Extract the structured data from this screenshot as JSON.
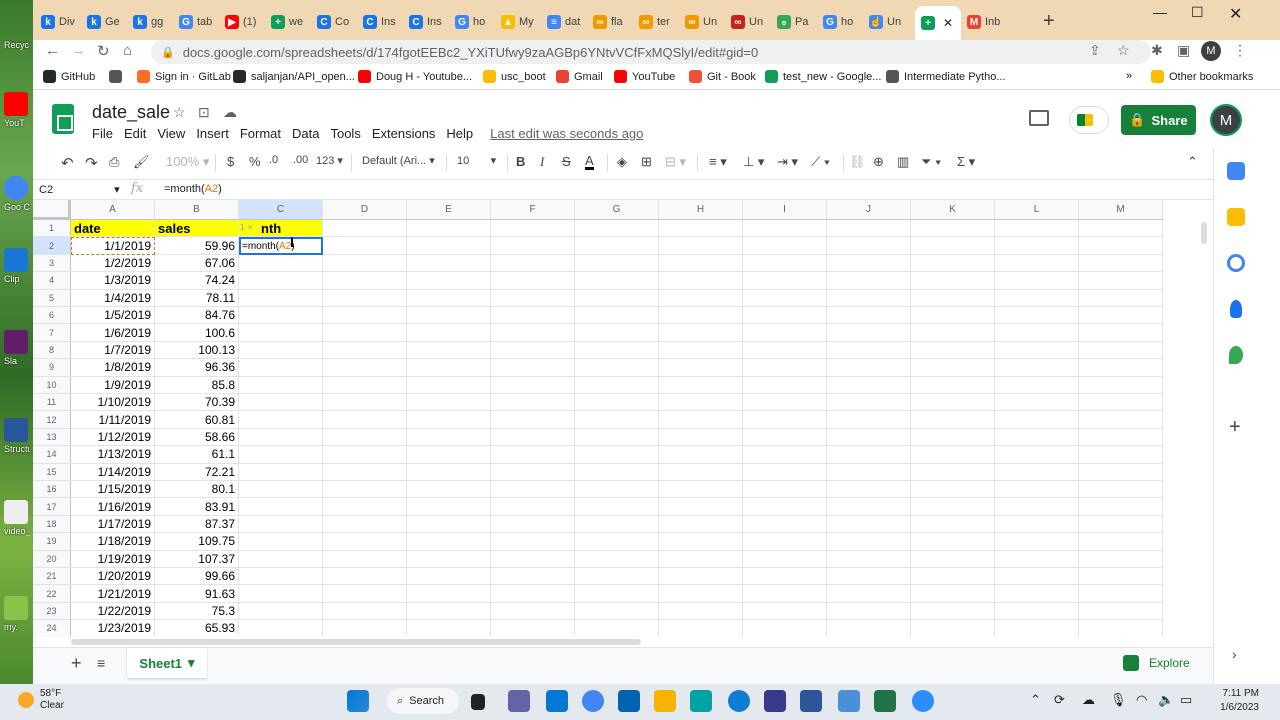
{
  "browser": {
    "tabs": [
      {
        "label": "Div",
        "fav": "k",
        "color": "#1a73e8"
      },
      {
        "label": "Ge",
        "fav": "k",
        "color": "#1a73e8"
      },
      {
        "label": "gg",
        "fav": "k",
        "color": "#1a73e8"
      },
      {
        "label": "tab",
        "fav": "G",
        "color": "#4285f4"
      },
      {
        "label": "(1)",
        "fav": "▶",
        "color": "#ff0000"
      },
      {
        "label": "we",
        "fav": "+",
        "color": "#0f9d58"
      },
      {
        "label": "Co",
        "fav": "C",
        "color": "#1a73e8"
      },
      {
        "label": "Ins",
        "fav": "C",
        "color": "#1a73e8"
      },
      {
        "label": "Ins",
        "fav": "C",
        "color": "#1a73e8"
      },
      {
        "label": "ho",
        "fav": "G",
        "color": "#4285f4"
      },
      {
        "label": "My",
        "fav": "▲",
        "color": "#fbbc04"
      },
      {
        "label": "dat",
        "fav": "≡",
        "color": "#4285f4"
      },
      {
        "label": "fla",
        "fav": "∞",
        "color": "#f29900"
      },
      {
        "label": "ter",
        "fav": "∞",
        "color": "#f29900"
      },
      {
        "label": "Un",
        "fav": "∞",
        "color": "#f29900"
      },
      {
        "label": "Un",
        "fav": "∞",
        "color": "#c5221f"
      },
      {
        "label": "Pa",
        "fav": "ℴ",
        "color": "#34a853"
      },
      {
        "label": "ho",
        "fav": "G",
        "color": "#4285f4"
      },
      {
        "label": "Un",
        "fav": "☝",
        "color": "#4285f4"
      },
      {
        "label": "",
        "fav": "+",
        "color": "#0f9d58"
      },
      {
        "label": "Inb",
        "fav": "M",
        "color": "#ea4335"
      }
    ],
    "url": "docs.google.com/spreadsheets/d/174fgotEEBc2_YXiTUfwy9zaAGBp6YNtvVCfFxMQSlyI/edit#gid=0",
    "profile_initial": "M",
    "bookmarks": [
      {
        "label": "GitHub",
        "color": "#24292e"
      },
      {
        "label": "",
        "color": "#555555"
      },
      {
        "label": "Sign in · GitLab",
        "color": "#fc6d26"
      },
      {
        "label": "saljanjan/API_open...",
        "color": "#24292e"
      },
      {
        "label": "Doug H - Youtube...",
        "color": "#ff0000"
      },
      {
        "label": "usc_boot",
        "color": "#fbbc04"
      },
      {
        "label": "Gmail",
        "color": "#ea4335"
      },
      {
        "label": "YouTube",
        "color": "#ff0000"
      },
      {
        "label": "Git - Book",
        "color": "#f05033"
      },
      {
        "label": "test_new - Google...",
        "color": "#0f9d58"
      },
      {
        "label": "Intermediate Pytho...",
        "color": "#555555"
      }
    ],
    "more_bookmarks": "»",
    "other_bookmarks": "Other bookmarks"
  },
  "sheets": {
    "title": "date_sale",
    "menu": [
      "File",
      "Edit",
      "View",
      "Insert",
      "Format",
      "Data",
      "Tools",
      "Extensions",
      "Help"
    ],
    "last_edit": "Last edit was seconds ago",
    "share_label": "Share",
    "account_initial": "M",
    "toolbar": {
      "zoom": "100%",
      "currency": "$",
      "percent": "%",
      "dec_decrease": ".0",
      "dec_increase": ".00",
      "format_more": "123",
      "font": "Default (Ari...",
      "font_size": "10",
      "bold": "B",
      "italic": "I",
      "strike": "S",
      "text_color": "A"
    },
    "name_box": "C2",
    "fx": "fx",
    "formula_prefix": "=month(",
    "formula_ref": "A2",
    "formula_suffix": ")",
    "columns": [
      "A",
      "B",
      "C",
      "D",
      "E",
      "F",
      "G",
      "H",
      "I",
      "J",
      "K",
      "L",
      "M"
    ],
    "header_row": {
      "a": "date",
      "b": "sales",
      "c": "nth"
    },
    "edit_cell": {
      "prefix": "=month(",
      "ref": "A2",
      "suffix": ")"
    },
    "edit_hint": "1 ×",
    "rows": [
      {
        "n": "2",
        "date": "1/1/2019",
        "sales": "59.96"
      },
      {
        "n": "3",
        "date": "1/2/2019",
        "sales": "67.06"
      },
      {
        "n": "4",
        "date": "1/3/2019",
        "sales": "74.24"
      },
      {
        "n": "5",
        "date": "1/4/2019",
        "sales": "78.11"
      },
      {
        "n": "6",
        "date": "1/5/2019",
        "sales": "84.76"
      },
      {
        "n": "7",
        "date": "1/6/2019",
        "sales": "100.6"
      },
      {
        "n": "8",
        "date": "1/7/2019",
        "sales": "100.13"
      },
      {
        "n": "9",
        "date": "1/8/2019",
        "sales": "96.36"
      },
      {
        "n": "10",
        "date": "1/9/2019",
        "sales": "85.8"
      },
      {
        "n": "11",
        "date": "1/10/2019",
        "sales": "70.39"
      },
      {
        "n": "12",
        "date": "1/11/2019",
        "sales": "60.81"
      },
      {
        "n": "13",
        "date": "1/12/2019",
        "sales": "58.66"
      },
      {
        "n": "14",
        "date": "1/13/2019",
        "sales": "61.1"
      },
      {
        "n": "15",
        "date": "1/14/2019",
        "sales": "72.21"
      },
      {
        "n": "16",
        "date": "1/15/2019",
        "sales": "80.1"
      },
      {
        "n": "17",
        "date": "1/16/2019",
        "sales": "83.91"
      },
      {
        "n": "18",
        "date": "1/17/2019",
        "sales": "87.37"
      },
      {
        "n": "19",
        "date": "1/18/2019",
        "sales": "109.75"
      },
      {
        "n": "20",
        "date": "1/19/2019",
        "sales": "107.37"
      },
      {
        "n": "21",
        "date": "1/20/2019",
        "sales": "99.66"
      },
      {
        "n": "22",
        "date": "1/21/2019",
        "sales": "91.63"
      },
      {
        "n": "23",
        "date": "1/22/2019",
        "sales": "75.3"
      },
      {
        "n": "24",
        "date": "1/23/2019",
        "sales": "65.93"
      }
    ],
    "sheet_tab": "Sheet1",
    "explore": "Explore"
  },
  "desktop": {
    "icons": [
      "Recyc",
      "YouT",
      "Goo Chro",
      "Clip",
      "Sla",
      "Structu",
      "video_",
      "my."
    ]
  },
  "taskbar": {
    "temp": "58°F",
    "condition": "Clear",
    "search": "Search",
    "time": "7:11 PM",
    "date": "1/6/2023"
  },
  "colors": {
    "header_fill": "#ffff00",
    "accent_green": "#188038",
    "selection_blue": "#1a73e8",
    "tab_strip": "#f1d8b4"
  }
}
